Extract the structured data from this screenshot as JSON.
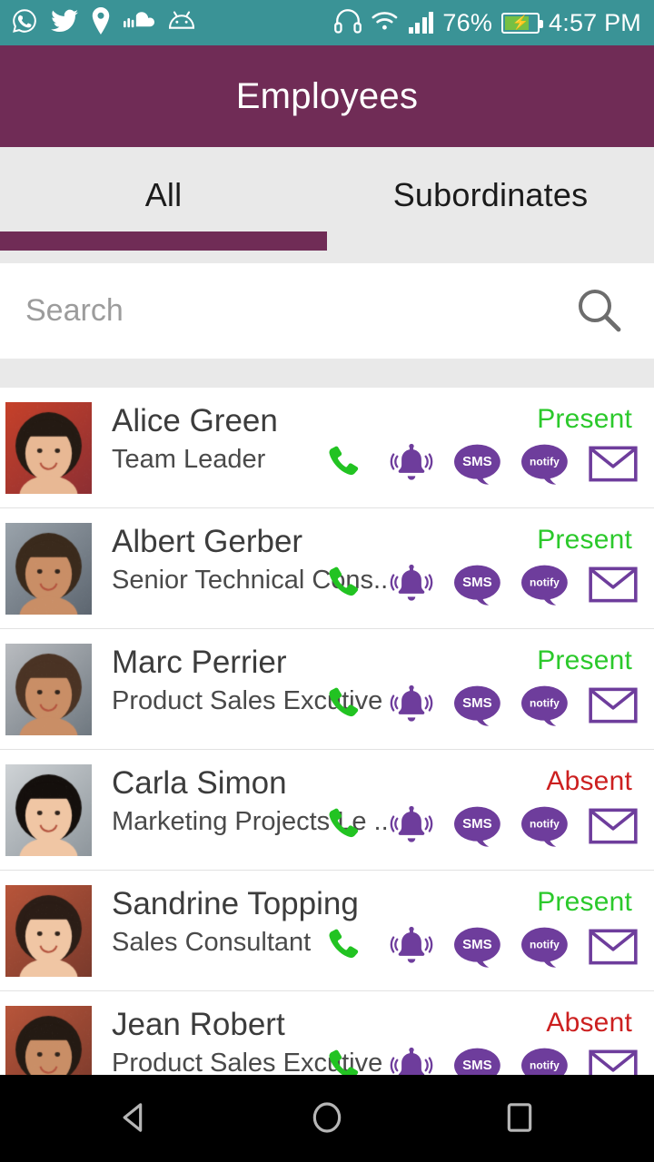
{
  "status_bar": {
    "left_icons": [
      "whatsapp-icon",
      "twitter-icon",
      "location-pin-icon",
      "soundcloud-icon",
      "android-icon"
    ],
    "right_icons": [
      "headphones-icon",
      "wifi-icon",
      "signal-icon"
    ],
    "battery_percent": "76%",
    "battery_level": 76,
    "battery_charging": true,
    "time": "4:57 PM",
    "background_color": "#3a9396"
  },
  "app_bar": {
    "title": "Employees",
    "background_color": "#702c56"
  },
  "tabs": {
    "items": [
      {
        "label": "All",
        "active": true
      },
      {
        "label": "Subordinates",
        "active": false
      }
    ],
    "indicator_color": "#702c56",
    "background_color": "#e9e9e9"
  },
  "search": {
    "value": "",
    "placeholder": "Search",
    "icon": "search-icon"
  },
  "actions": {
    "call": "call-icon",
    "ring": "ring-bell-icon",
    "sms": "SMS",
    "notify": "notify",
    "email": "email-icon",
    "call_color": "#22c322",
    "purple_color": "#6e3d9c"
  },
  "status_colors": {
    "present": "#2bc92b",
    "absent": "#cc1f1f"
  },
  "employees": [
    {
      "name": "Alice Green",
      "role": "Team Leader",
      "status": "Present",
      "status_kind": "present",
      "avatar": "photo-woman-dark-hair-red-bg"
    },
    {
      "name": "Albert Gerber",
      "role": "Senior Technical Cons..",
      "status": "Present",
      "status_kind": "present",
      "avatar": "photo-man-dark-suit"
    },
    {
      "name": "Marc Perrier",
      "role": "Product Sales Excutive",
      "status": "Present",
      "status_kind": "present",
      "avatar": "photo-man-short-hair-grey-bg"
    },
    {
      "name": "Carla Simon",
      "role": "Marketing Projects Le ..",
      "status": "Absent",
      "status_kind": "absent",
      "avatar": "photo-woman-brown-hair-dark-bg"
    },
    {
      "name": "Sandrine Topping",
      "role": "Sales Consultant",
      "status": "Present",
      "status_kind": "present",
      "avatar": "photo-woman-curly-hair-outdoor"
    },
    {
      "name": "Jean Robert",
      "role": "Product Sales Excutive",
      "status": "Absent",
      "status_kind": "absent",
      "avatar": "photo-woman-curly-hair-smiling"
    }
  ],
  "nav_bar": {
    "back": "back-triangle-icon",
    "home": "home-circle-icon",
    "recents": "recents-square-icon"
  }
}
